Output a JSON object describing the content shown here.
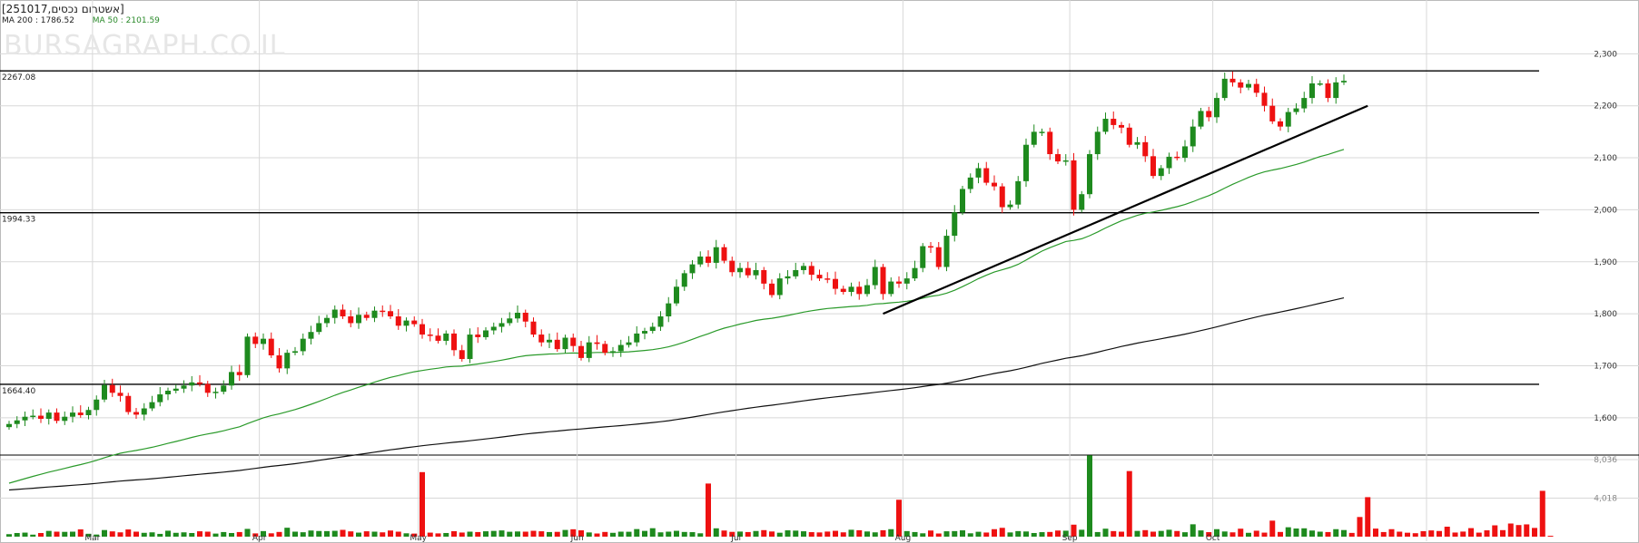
{
  "header": {
    "symbol_title": "[251017,אשטרום נכסים]",
    "ma200_label": "MA 200 : 1786.52",
    "ma50_label": "MA 50 : 2101.59",
    "ma50_color": "#2a8a2a",
    "watermark": "BURSAGRAPH.CO.IL"
  },
  "colors": {
    "up": "#1e8a1e",
    "down": "#ee1111",
    "ma50": "#2a9a2a",
    "ma200": "#111111",
    "grid": "#d8d8d8"
  },
  "chart_data": {
    "type": "candlestick",
    "price_axis": {
      "min": 1530,
      "max": 2325,
      "ticks": [
        "2,300",
        "2,200",
        "2,100",
        "2,000",
        "1,900",
        "1,800",
        "1,700",
        "1,600"
      ],
      "tick_values": [
        2300,
        2200,
        2100,
        2000,
        1900,
        1800,
        1700,
        1600
      ]
    },
    "volume_axis": {
      "max": 8036,
      "ticks": [
        "8,036",
        "4,018"
      ],
      "tick_values": [
        8036,
        4018
      ]
    },
    "months": [
      {
        "label": "Mar",
        "index": 11
      },
      {
        "label": "Apr",
        "index": 32
      },
      {
        "label": "May",
        "index": 52
      },
      {
        "label": "Jun",
        "index": 72
      },
      {
        "label": "Jul",
        "index": 92
      },
      {
        "label": "Aug",
        "index": 113
      },
      {
        "label": "Sep",
        "index": 134
      },
      {
        "label": "Oct",
        "index": 152
      }
    ],
    "levels": [
      {
        "label": "2267.08",
        "value": 2267.08
      },
      {
        "label": "1994.33",
        "value": 1994.33
      },
      {
        "label": "1664.40",
        "value": 1664.4
      }
    ],
    "trendline": {
      "from_index": 110,
      "from_value": 1800,
      "to_index": 171,
      "to_value": 2200
    },
    "ma50_start": 1470,
    "ma200_start": 1460,
    "closes": [
      1588,
      1595,
      1602,
      1604,
      1598,
      1610,
      1594,
      1602,
      1610,
      1605,
      1615,
      1635,
      1663,
      1648,
      1642,
      1611,
      1606,
      1618,
      1630,
      1645,
      1652,
      1656,
      1662,
      1668,
      1665,
      1648,
      1650,
      1662,
      1688,
      1682,
      1756,
      1742,
      1752,
      1720,
      1695,
      1725,
      1728,
      1752,
      1765,
      1782,
      1792,
      1808,
      1795,
      1782,
      1798,
      1792,
      1806,
      1805,
      1795,
      1777,
      1787,
      1780,
      1760,
      1758,
      1748,
      1762,
      1730,
      1713,
      1760,
      1755,
      1768,
      1775,
      1782,
      1791,
      1802,
      1785,
      1760,
      1745,
      1750,
      1732,
      1754,
      1738,
      1715,
      1745,
      1742,
      1725,
      1728,
      1740,
      1745,
      1762,
      1767,
      1775,
      1795,
      1820,
      1852,
      1878,
      1895,
      1910,
      1898,
      1928,
      1902,
      1880,
      1888,
      1874,
      1884,
      1858,
      1836,
      1868,
      1872,
      1884,
      1892,
      1875,
      1868,
      1867,
      1848,
      1842,
      1852,
      1838,
      1855,
      1890,
      1838,
      1862,
      1858,
      1868,
      1888,
      1930,
      1928,
      1890,
      1950,
      1995,
      2040,
      2062,
      2080,
      2052,
      2045,
      2005,
      2010,
      2055,
      2125,
      2150,
      2150,
      2107,
      2093,
      2095,
      2000,
      2030,
      2107,
      2150,
      2175,
      2163,
      2158,
      2125,
      2130,
      2103,
      2065,
      2080,
      2102,
      2100,
      2122,
      2160,
      2190,
      2178,
      2215,
      2252,
      2245,
      2235,
      2242,
      2225,
      2200,
      2170,
      2160,
      2188,
      2195,
      2215,
      2243,
      2243,
      2215,
      2245,
      2248
    ],
    "volumes": [
      260,
      380,
      420,
      210,
      380,
      600,
      520,
      500,
      520,
      760,
      300,
      220,
      690,
      550,
      450,
      750,
      520,
      400,
      450,
      290,
      620,
      400,
      450,
      380,
      560,
      520,
      320,
      480,
      380,
      480,
      810,
      340,
      580,
      350,
      490,
      930,
      520,
      460,
      640,
      590,
      580,
      610,
      710,
      550,
      420,
      560,
      520,
      450,
      640,
      520,
      350,
      320,
      6730,
      420,
      340,
      380,
      570,
      430,
      520,
      480,
      560,
      600,
      650,
      510,
      540,
      520,
      610,
      560,
      480,
      500,
      700,
      770,
      660,
      440,
      330,
      490,
      400,
      520,
      510,
      790,
      600,
      880,
      450,
      520,
      610,
      490,
      470,
      350,
      5540,
      870,
      640,
      500,
      530,
      480,
      590,
      680,
      540,
      410,
      660,
      630,
      560,
      470,
      440,
      530,
      610,
      450,
      720,
      670,
      540,
      450,
      670,
      780,
      3850,
      580,
      480,
      350,
      640,
      330,
      560,
      580,
      660,
      350,
      510,
      430,
      780,
      920,
      440,
      580,
      540,
      380,
      470,
      490,
      640,
      620,
      1250,
      720,
      8480,
      480,
      830,
      580,
      520,
      6840,
      600,
      680,
      520,
      600,
      720,
      590,
      460,
      1290,
      650,
      470,
      780,
      540,
      450,
      830,
      400,
      620,
      420,
      1670,
      490,
      980,
      850,
      870,
      640,
      520,
      480,
      780,
      690,
      390,
      2050,
      4120,
      840,
      480,
      780,
      520,
      410,
      360,
      570,
      650,
      590,
      1040,
      430,
      530,
      890,
      420,
      660,
      1180,
      680,
      1370,
      1210,
      1280,
      910,
      4780,
      90
    ]
  }
}
